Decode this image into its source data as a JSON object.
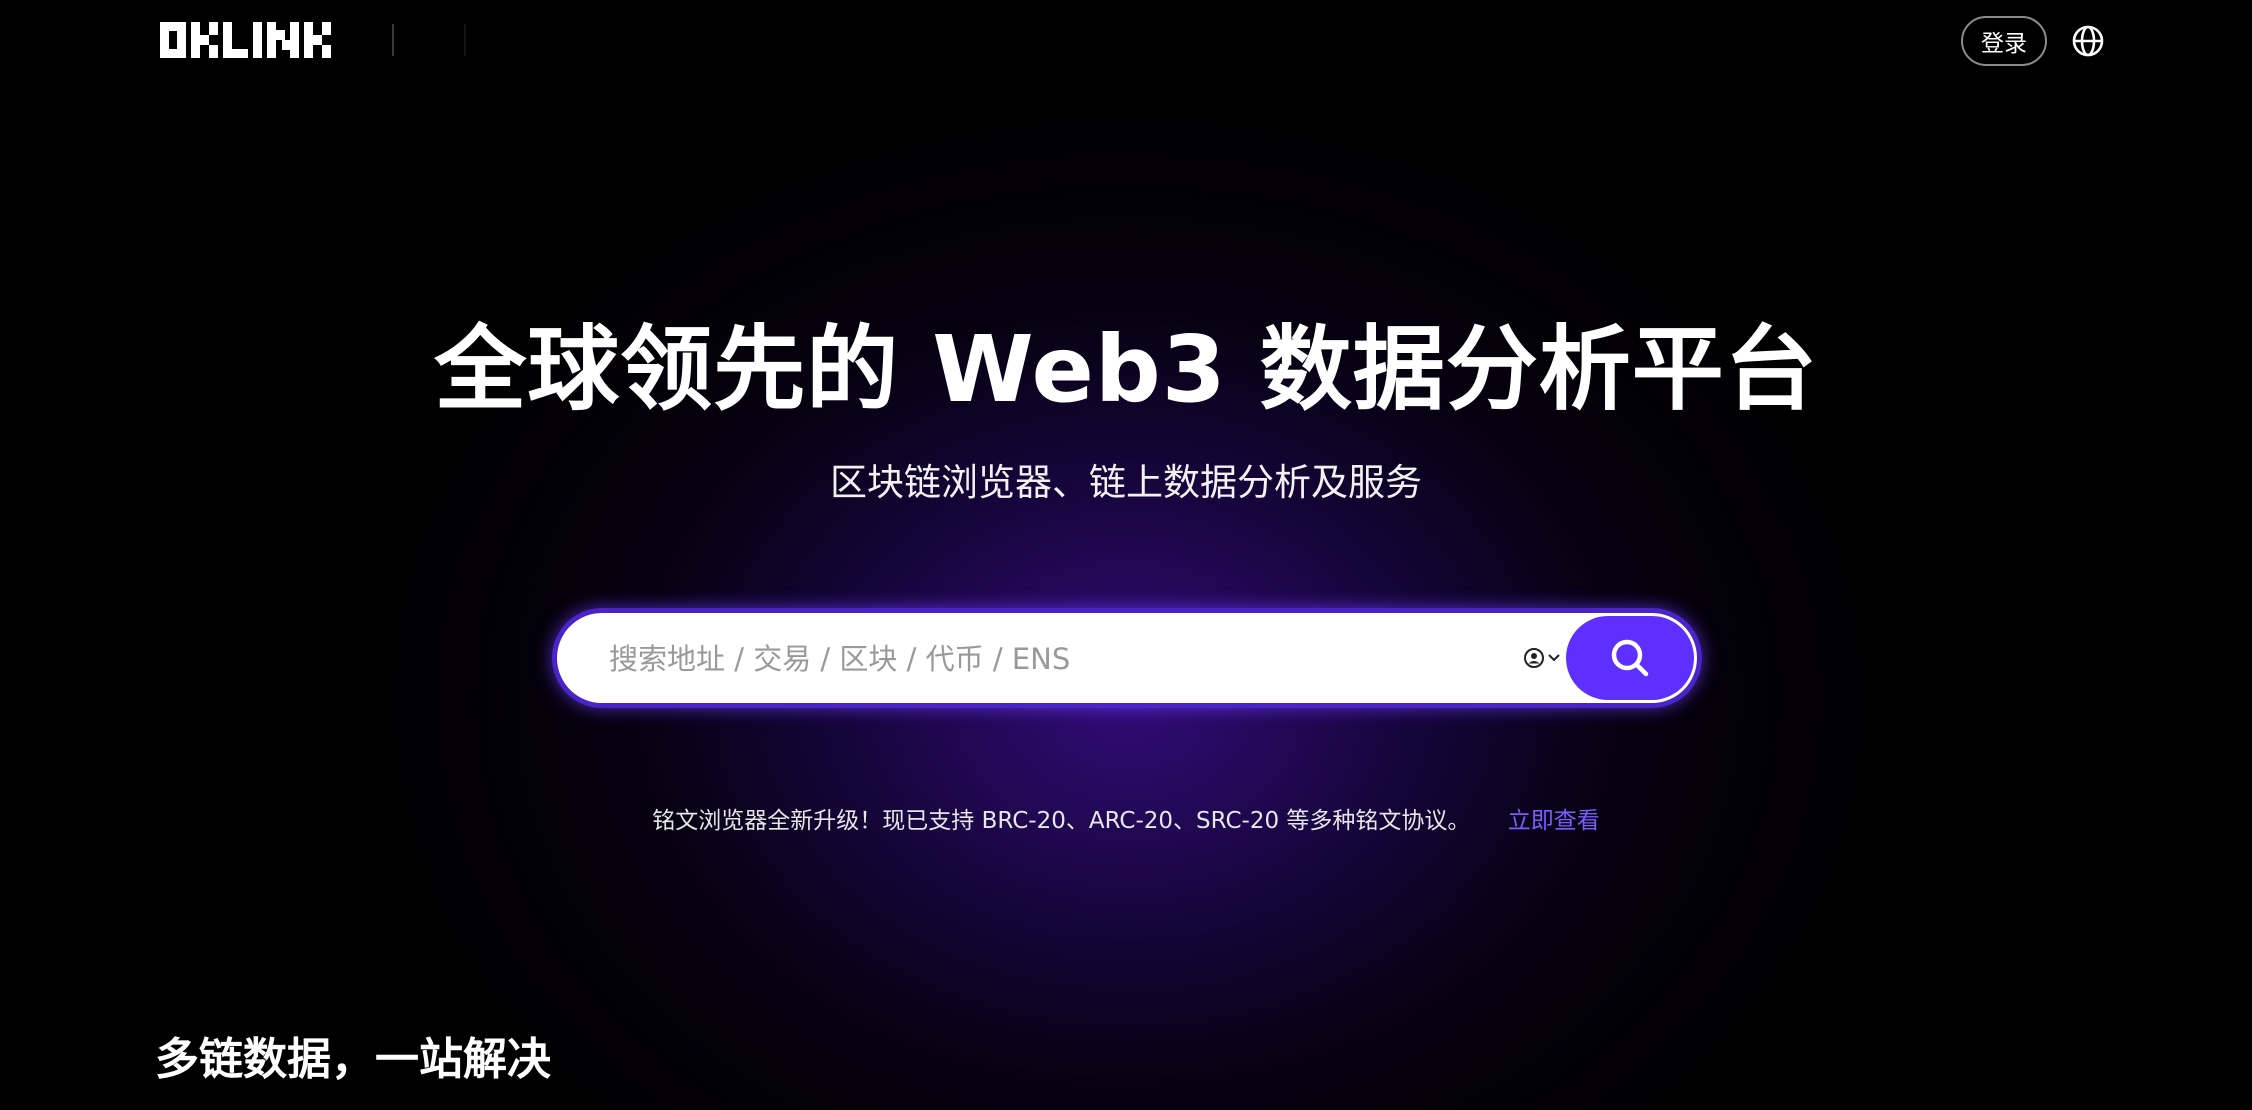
{
  "header": {
    "logo_alt": "OKLINK",
    "login_label": "登录",
    "language_icon": "globe-icon"
  },
  "hero": {
    "title": "全球领先的 Web3 数据分析平台",
    "subtitle": "区块链浏览器、链上数据分析及服务"
  },
  "search": {
    "placeholder": "搜索地址 / 交易 / 区块 / 代币 / ENS",
    "value": "",
    "filter_icon": "user-circle-icon",
    "button_icon": "search-icon"
  },
  "notice": {
    "text": "铭文浏览器全新升级！现已支持 BRC-20、ARC-20、SRC-20 等多种铭文协议。",
    "link_label": "立即查看"
  },
  "section": {
    "title": "多链数据，一站解决"
  },
  "colors": {
    "background": "#000000",
    "accent": "#5e2fff",
    "link": "#7b5cff",
    "search_border": "#4a23c9"
  }
}
